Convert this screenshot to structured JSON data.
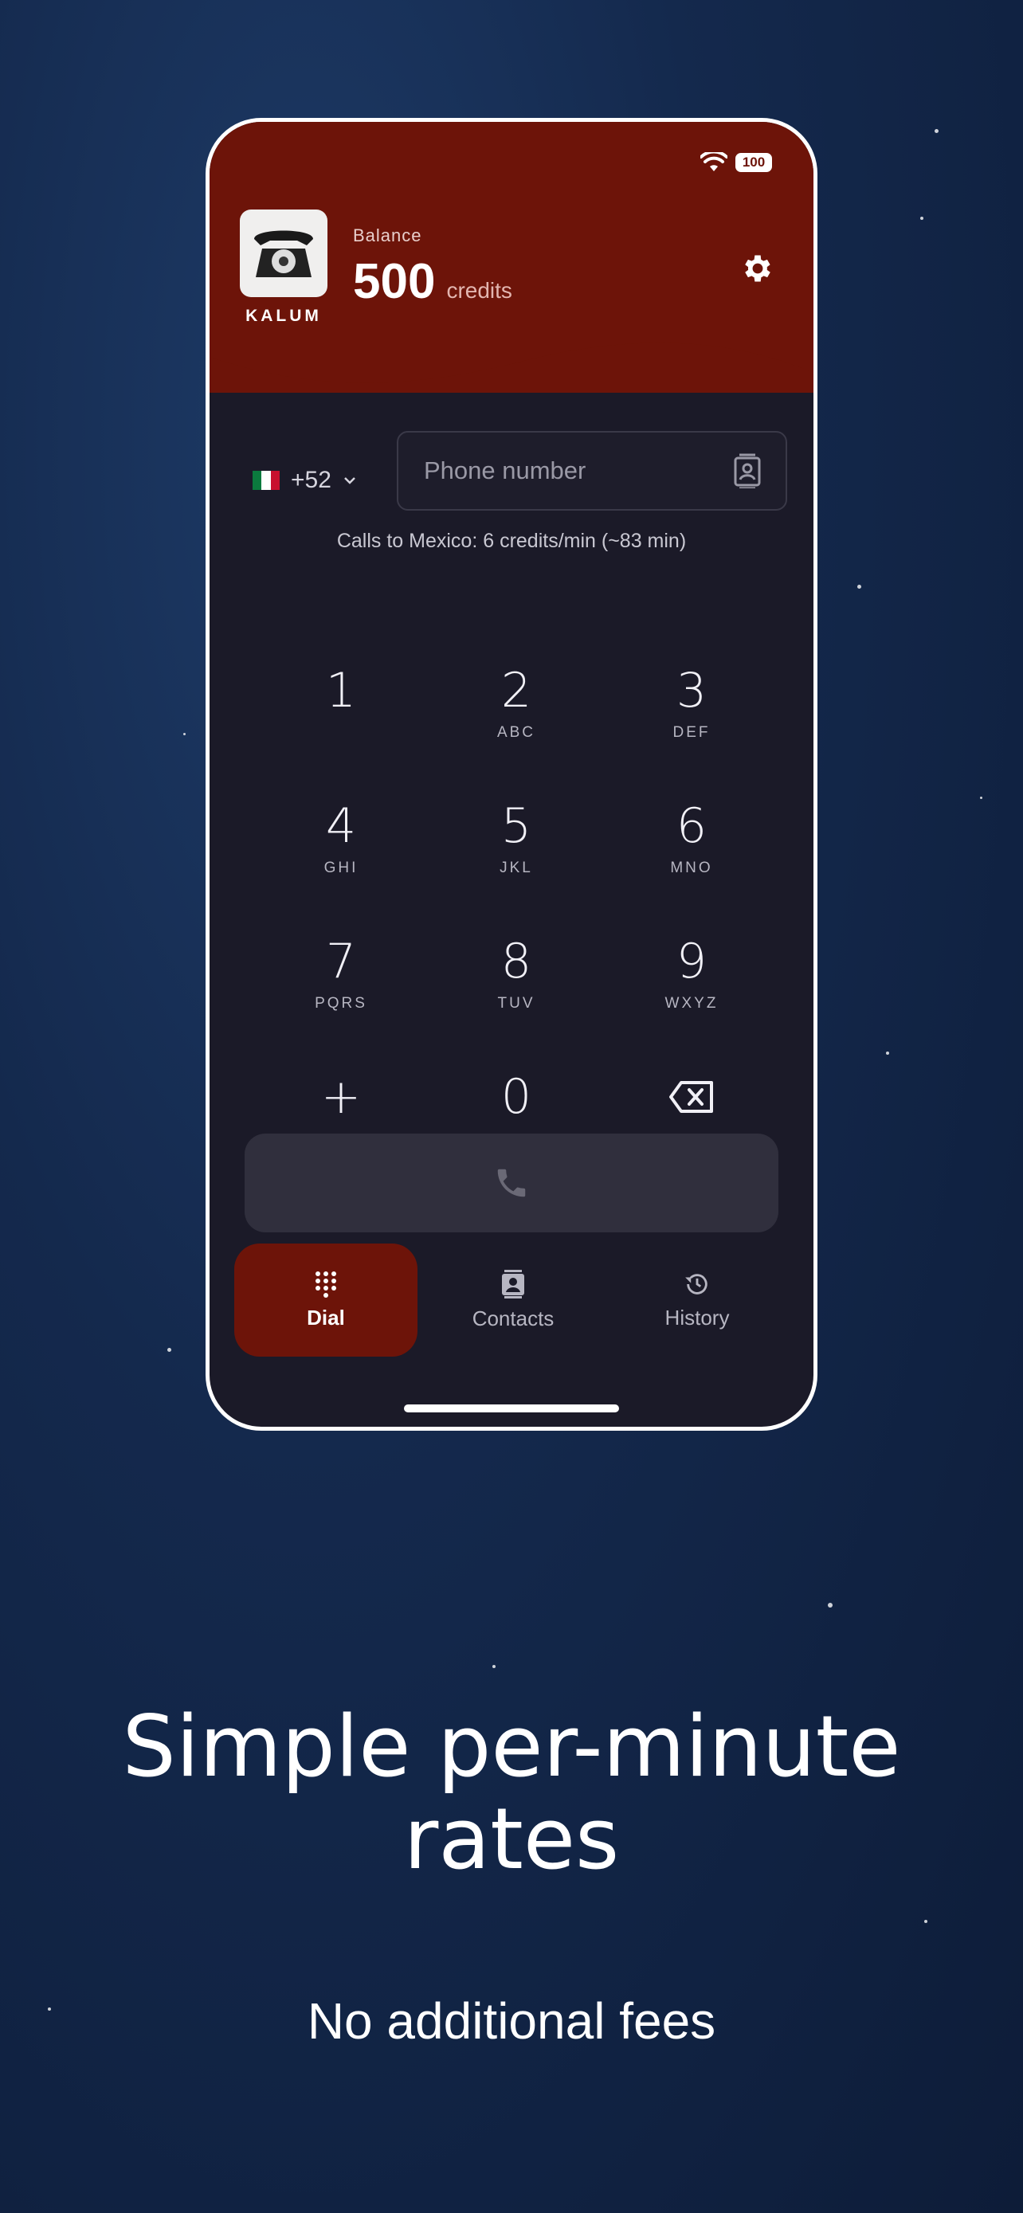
{
  "status_bar": {
    "battery": "100",
    "icons": [
      "wifi-icon",
      "battery-icon"
    ]
  },
  "header": {
    "brand": "KALUM",
    "balance_label": "Balance",
    "balance_value": "500",
    "balance_unit": "credits",
    "settings_icon": "gear-icon"
  },
  "dialer": {
    "country_code": "+52",
    "country_flag": "mexico-flag",
    "phone_placeholder": "Phone number",
    "rate_text": "Calls to Mexico: 6 credits/min  (~83 min)",
    "keys": [
      {
        "digit": "1",
        "letters": ""
      },
      {
        "digit": "2",
        "letters": "ABC"
      },
      {
        "digit": "3",
        "letters": "DEF"
      },
      {
        "digit": "4",
        "letters": "GHI"
      },
      {
        "digit": "5",
        "letters": "JKL"
      },
      {
        "digit": "6",
        "letters": "MNO"
      },
      {
        "digit": "7",
        "letters": "PQRS"
      },
      {
        "digit": "8",
        "letters": "TUV"
      },
      {
        "digit": "9",
        "letters": "WXYZ"
      },
      {
        "digit": "+",
        "letters": ""
      },
      {
        "digit": "0",
        "letters": ""
      }
    ]
  },
  "nav": {
    "items": [
      {
        "label": "Dial",
        "icon": "dialpad-icon",
        "active": true
      },
      {
        "label": "Contacts",
        "icon": "contacts-icon",
        "active": false
      },
      {
        "label": "History",
        "icon": "history-icon",
        "active": false
      }
    ]
  },
  "promo": {
    "headline": "Simple per-minute rates",
    "subline": "No additional fees"
  },
  "colors": {
    "brand_red": "#6d1409",
    "app_bg": "#1b1a28",
    "page_bg": "#14294d"
  }
}
